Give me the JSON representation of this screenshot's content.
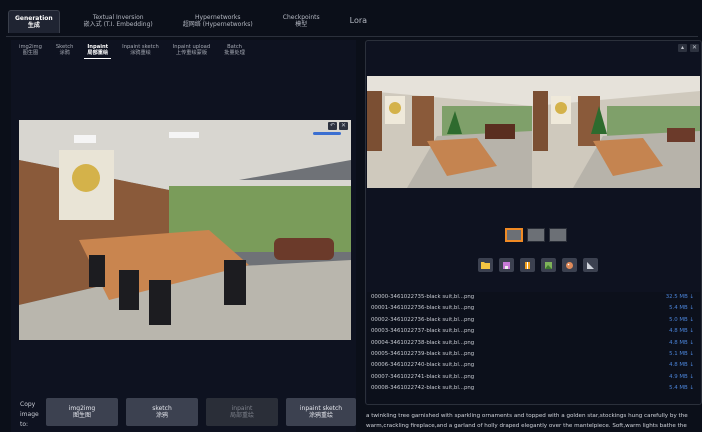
{
  "top_tabs": [
    {
      "l1": "Generation",
      "l2": "生成"
    },
    {
      "l1": "Textual Inversion",
      "l2": "嵌入式 (T.I. Embedding)"
    },
    {
      "l1": "Hypernetworks",
      "l2": "超网络 (Hypernetworks)"
    },
    {
      "l1": "Checkpoints",
      "l2": "模型"
    },
    {
      "l1": "Lora",
      "l2": ""
    }
  ],
  "sub_tabs": [
    {
      "l1": "img2img",
      "l2": "图生图"
    },
    {
      "l1": "Sketch",
      "l2": "涂鸦"
    },
    {
      "l1": "Inpaint",
      "l2": "局部重绘"
    },
    {
      "l1": "Inpaint sketch",
      "l2": "涂鸦重绘"
    },
    {
      "l1": "Inpaint upload",
      "l2": "上传重绘蒙版"
    },
    {
      "l1": "Batch",
      "l2": "批量处理"
    }
  ],
  "copy_image_label": "Copy image to:",
  "copy_buttons": [
    {
      "l1": "img2img",
      "l2": "图生图"
    },
    {
      "l1": "sketch",
      "l2": "涂鸦"
    },
    {
      "l1": "inpaint",
      "l2": "局部重绘"
    },
    {
      "l1": "inpaint sketch",
      "l2": "涂鸦重绘"
    }
  ],
  "files": [
    {
      "name": "00000-3461022735-black suit,bl...png",
      "size": "32.5 MB ↓"
    },
    {
      "name": "00001-3461022736-black suit,bl...png",
      "size": "5.4 MB ↓"
    },
    {
      "name": "00002-3461022736-black suit,bl...png",
      "size": "5.0 MB ↓"
    },
    {
      "name": "00003-3461022737-black suit,bl...png",
      "size": "4.8 MB ↓"
    },
    {
      "name": "00004-3461022738-black suit,bl...png",
      "size": "4.8 MB ↓"
    },
    {
      "name": "00005-3461022739-black suit,bl...png",
      "size": "5.1 MB ↓"
    },
    {
      "name": "00006-3461022740-black suit,bl...png",
      "size": "4.8 MB ↓"
    },
    {
      "name": "00007-3461022741-black suit,bl...png",
      "size": "4.9 MB ↓"
    },
    {
      "name": "00008-3461022742-black suit,bl...png",
      "size": "5.4 MB ↓"
    }
  ],
  "caption": "a twinkling tree garnished with sparkling ornaments and topped with a golden star,stockings hung carefully by the warm,crackling fireplace,and a garland of holly draped elegantly over the mantelpiece. Soft,warm lights bathe the room in a",
  "icons": {
    "folder": "folder-icon",
    "save": "save-icon",
    "zip": "zip-icon",
    "image": "image-icon",
    "palette": "palette-icon",
    "ruler": "ruler-icon",
    "close": "close-icon",
    "expand": "expand-icon"
  },
  "colors": {
    "accent": "#f08a24",
    "link": "#4a82d6",
    "bg": "#0b0f19"
  }
}
